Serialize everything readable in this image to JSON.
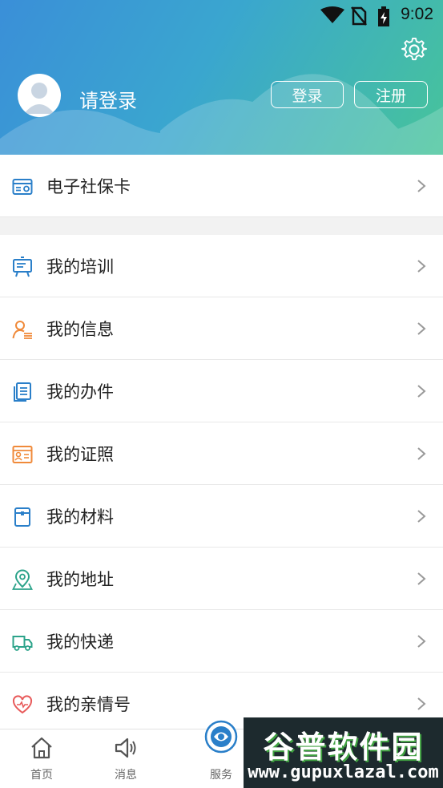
{
  "status_bar": {
    "time": "9:02"
  },
  "header": {
    "login_prompt": "请登录",
    "login_button": "登录",
    "register_button": "注册"
  },
  "top_card": {
    "items": [
      {
        "label": "电子社保卡",
        "icon": "social-security-card-icon"
      }
    ]
  },
  "menu": {
    "items": [
      {
        "label": "我的培训",
        "icon": "training-board-icon",
        "color": "#2a7fc9"
      },
      {
        "label": "我的信息",
        "icon": "person-info-icon",
        "color": "#f08a3a"
      },
      {
        "label": "我的办件",
        "icon": "documents-icon",
        "color": "#2a7fc9"
      },
      {
        "label": "我的证照",
        "icon": "id-card-icon",
        "color": "#f08a3a"
      },
      {
        "label": "我的材料",
        "icon": "folder-icon",
        "color": "#2a7fc9"
      },
      {
        "label": "我的地址",
        "icon": "location-pin-icon",
        "color": "#2ca38a"
      },
      {
        "label": "我的快递",
        "icon": "delivery-truck-icon",
        "color": "#2ca38a"
      },
      {
        "label": "我的亲情号",
        "icon": "heart-icon",
        "color": "#e85a5a"
      }
    ]
  },
  "tabbar": {
    "tabs": [
      {
        "label": "首页",
        "icon": "home-icon"
      },
      {
        "label": "消息",
        "icon": "speaker-icon"
      },
      {
        "label": "服务",
        "icon": "service-logo-icon"
      }
    ]
  },
  "watermark": {
    "title": "谷普软件园",
    "url": "www.gupuxlazal.com"
  },
  "colors": {
    "header_start": "#3a8fd8",
    "header_end": "#47c49a",
    "accent_blue": "#2a7fc9",
    "accent_orange": "#f08a3a"
  }
}
